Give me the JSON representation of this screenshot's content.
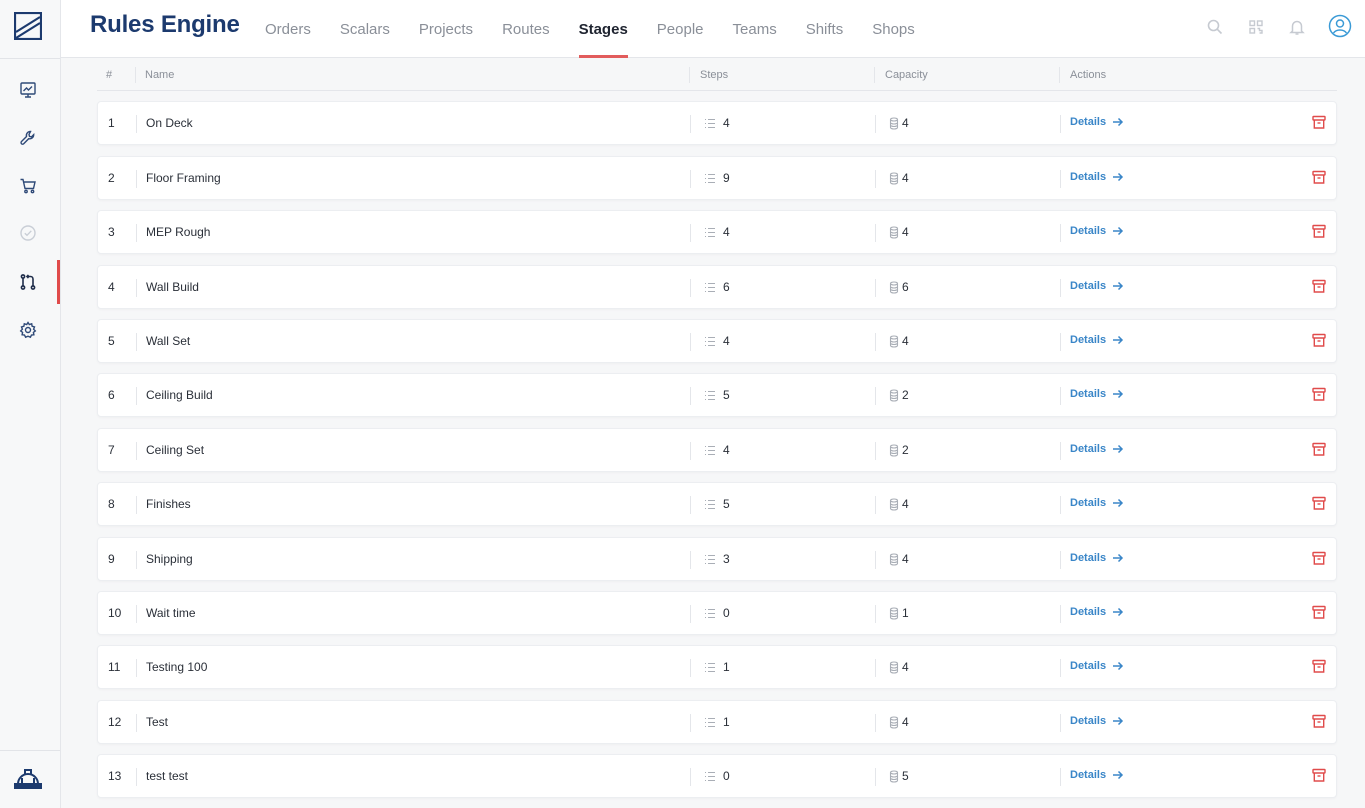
{
  "app": {
    "title": "Rules Engine"
  },
  "nav_tabs": [
    {
      "label": "Orders",
      "active": false
    },
    {
      "label": "Scalars",
      "active": false
    },
    {
      "label": "Projects",
      "active": false
    },
    {
      "label": "Routes",
      "active": false
    },
    {
      "label": "Stages",
      "active": true
    },
    {
      "label": "People",
      "active": false
    },
    {
      "label": "Teams",
      "active": false
    },
    {
      "label": "Shifts",
      "active": false
    },
    {
      "label": "Shops",
      "active": false
    }
  ],
  "sidebar": {
    "items": [
      {
        "icon": "chart-presentation-icon",
        "active": false
      },
      {
        "icon": "wrench-icon",
        "active": false
      },
      {
        "icon": "cart-icon",
        "active": false
      },
      {
        "icon": "check-circle-icon",
        "active": false
      },
      {
        "icon": "git-pull-request-icon",
        "active": true
      },
      {
        "icon": "gear-icon",
        "active": false
      }
    ],
    "bottom_icon": "hard-hat-icon"
  },
  "header_icons": [
    "search-icon",
    "qr-code-icon",
    "bell-icon",
    "user-avatar-icon"
  ],
  "table": {
    "columns": [
      "#",
      "Name",
      "Steps",
      "Capacity",
      "Actions"
    ],
    "action_label": "Details",
    "rows": [
      {
        "num": "1",
        "name": "On Deck",
        "steps": "4",
        "capacity": "4"
      },
      {
        "num": "2",
        "name": "Floor Framing",
        "steps": "9",
        "capacity": "4"
      },
      {
        "num": "3",
        "name": "MEP Rough",
        "steps": "4",
        "capacity": "4"
      },
      {
        "num": "4",
        "name": "Wall Build",
        "steps": "6",
        "capacity": "6"
      },
      {
        "num": "5",
        "name": "Wall Set",
        "steps": "4",
        "capacity": "4"
      },
      {
        "num": "6",
        "name": "Ceiling Build",
        "steps": "5",
        "capacity": "2"
      },
      {
        "num": "7",
        "name": "Ceiling Set",
        "steps": "4",
        "capacity": "2"
      },
      {
        "num": "8",
        "name": "Finishes",
        "steps": "5",
        "capacity": "4"
      },
      {
        "num": "9",
        "name": "Shipping",
        "steps": "3",
        "capacity": "4"
      },
      {
        "num": "10",
        "name": "Wait time",
        "steps": "0",
        "capacity": "1"
      },
      {
        "num": "11",
        "name": "Testing 100",
        "steps": "1",
        "capacity": "4"
      },
      {
        "num": "12",
        "name": "Test",
        "steps": "1",
        "capacity": "4"
      },
      {
        "num": "13",
        "name": "test test",
        "steps": "0",
        "capacity": "5"
      }
    ]
  },
  "colors": {
    "brand": "#1c3a6e",
    "accent_red": "#e25c5c",
    "link_blue": "#3a86c8",
    "trash_red": "#e04b4b"
  }
}
